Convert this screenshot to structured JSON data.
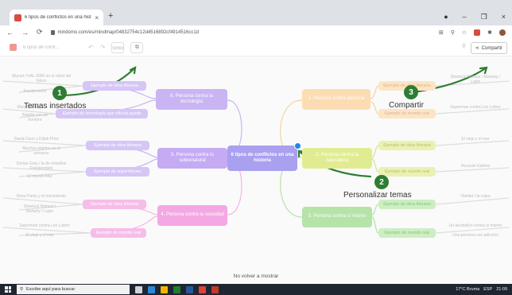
{
  "browser": {
    "tab_title": "6 tipos de conflictos en una hist...",
    "tab_close": "×",
    "new_tab": "+",
    "url": "mindomo.com/es/mindmap/04832754c12d4516892cf4914516cc1d",
    "win_controls": [
      "●",
      "–",
      "❐",
      "×"
    ]
  },
  "app": {
    "title": "6 tipos de confl...",
    "insert_theme_icon": "▭▭",
    "theme_icon": "⧉",
    "share_label": "Compartir",
    "not_show_again": "No volver a mostrar"
  },
  "annotations": {
    "temas_insertados": "Temas insertados",
    "compartir": "Compartir",
    "personalizar_temas": "Personalizar temas",
    "badges": [
      "1",
      "2",
      "3"
    ]
  },
  "mindmap": {
    "center": "6 tipos de conflictos en una historia",
    "topics": [
      "6. Persona contra la tecnología",
      "5. Persona contra lo sobrenatural",
      "4. Persona contra la sociedad",
      "1. Persona contra persona",
      "2. Persona contra la naturaleza",
      "3. Persona contra sí mismo"
    ],
    "subtopics": {
      "obra_literaria": "Ejemplo de obra literaria",
      "mundo_real": "Ejemplo de mundo real",
      "superheroes": "Ejemplo de superhéroes",
      "tecnologia_ficcion": "Ejemplo de tecnología que oficcia ayuda"
    },
    "leaves": [
      "Skynet / HAL 9000 en el robot del futuro",
      "Frankenstein",
      "Mary Shelley",
      "Batalla con un hombre",
      "David Dunn y Elijah Price",
      "Muchos objetos en el universo",
      "Dorian Gray / la de extraños Frankenstein",
      "El mundo feliz",
      "Rosa Parks y el movimiento",
      "Sherlock Holmes / Moriarty / Lupin",
      "Superman contra Lex Luthor",
      "El viejo y el mar",
      "Huracán Katrina",
      "Hamlet / la culpa",
      "Un alcohólico contra sí mismo",
      "Una persona con adicción"
    ]
  },
  "taskbar": {
    "search_placeholder": "Escribe aquí para buscar",
    "weather": "17°C Bruma",
    "time": "21:09",
    "lang": "ESP"
  },
  "colors": {
    "purple": "#b88bf0",
    "purple_sub": "#a9a0f0",
    "pink": "#f291df",
    "orange": "#fcd7a8",
    "yellow_green": "#dde88a",
    "green": "#a8e09a",
    "annot_green": "#2e7d32"
  }
}
